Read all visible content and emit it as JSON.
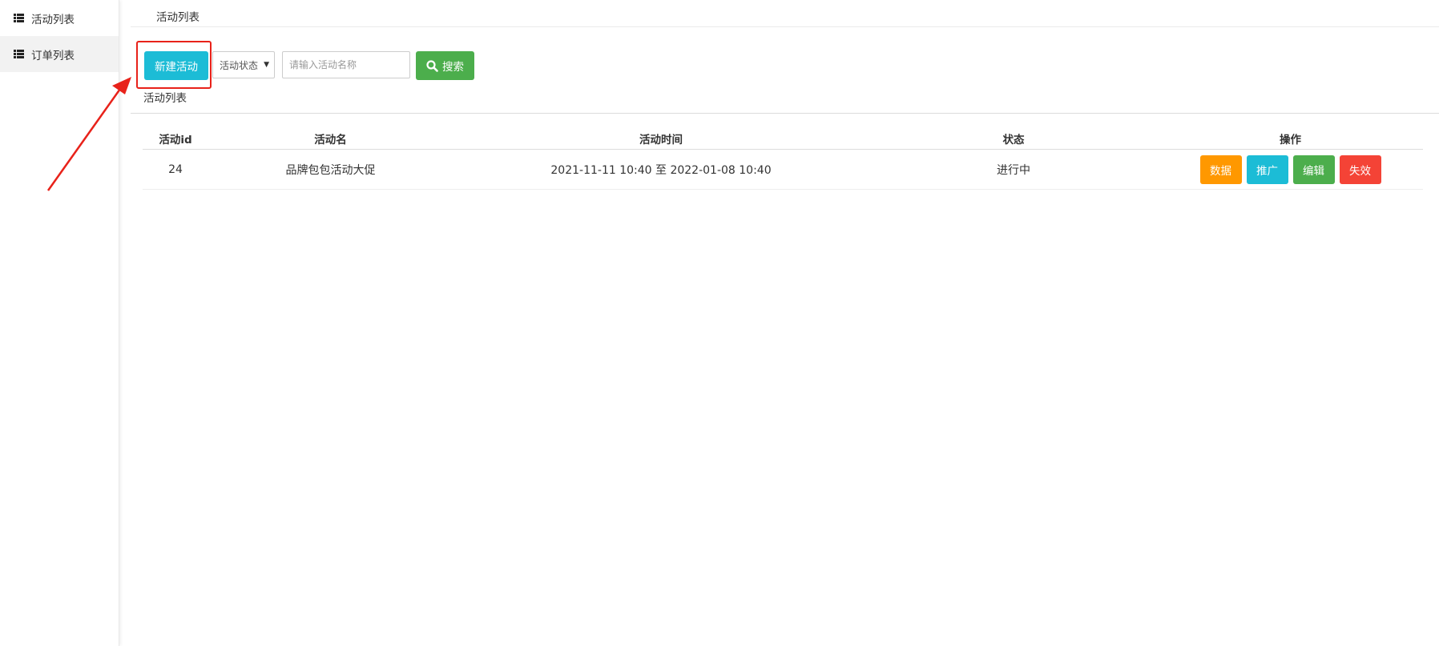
{
  "sidebar": {
    "items": [
      {
        "label": "活动列表",
        "icon": "list-icon"
      },
      {
        "label": "订单列表",
        "icon": "list-icon"
      }
    ]
  },
  "breadcrumb": "活动列表",
  "toolbar": {
    "new_label": "新建活动",
    "status_select": "活动状态",
    "search_placeholder": "请输入活动名称",
    "search_label": "搜索"
  },
  "section_title": "活动列表",
  "table": {
    "headers": [
      "活动id",
      "活动名",
      "活动时间",
      "状态",
      "操作"
    ],
    "rows": [
      {
        "id": "24",
        "name": "品牌包包活动大促",
        "time": "2021-11-11 10:40 至 2022-01-08 10:40",
        "status": "进行中",
        "actions": [
          "数据",
          "推广",
          "编辑",
          "失效"
        ]
      }
    ]
  },
  "colors": {
    "accent_cyan": "#1cbcd6",
    "success_green": "#4cae4c",
    "warning_orange": "#ff9800",
    "danger_red": "#f44336",
    "annotation_red": "#e8221a"
  }
}
